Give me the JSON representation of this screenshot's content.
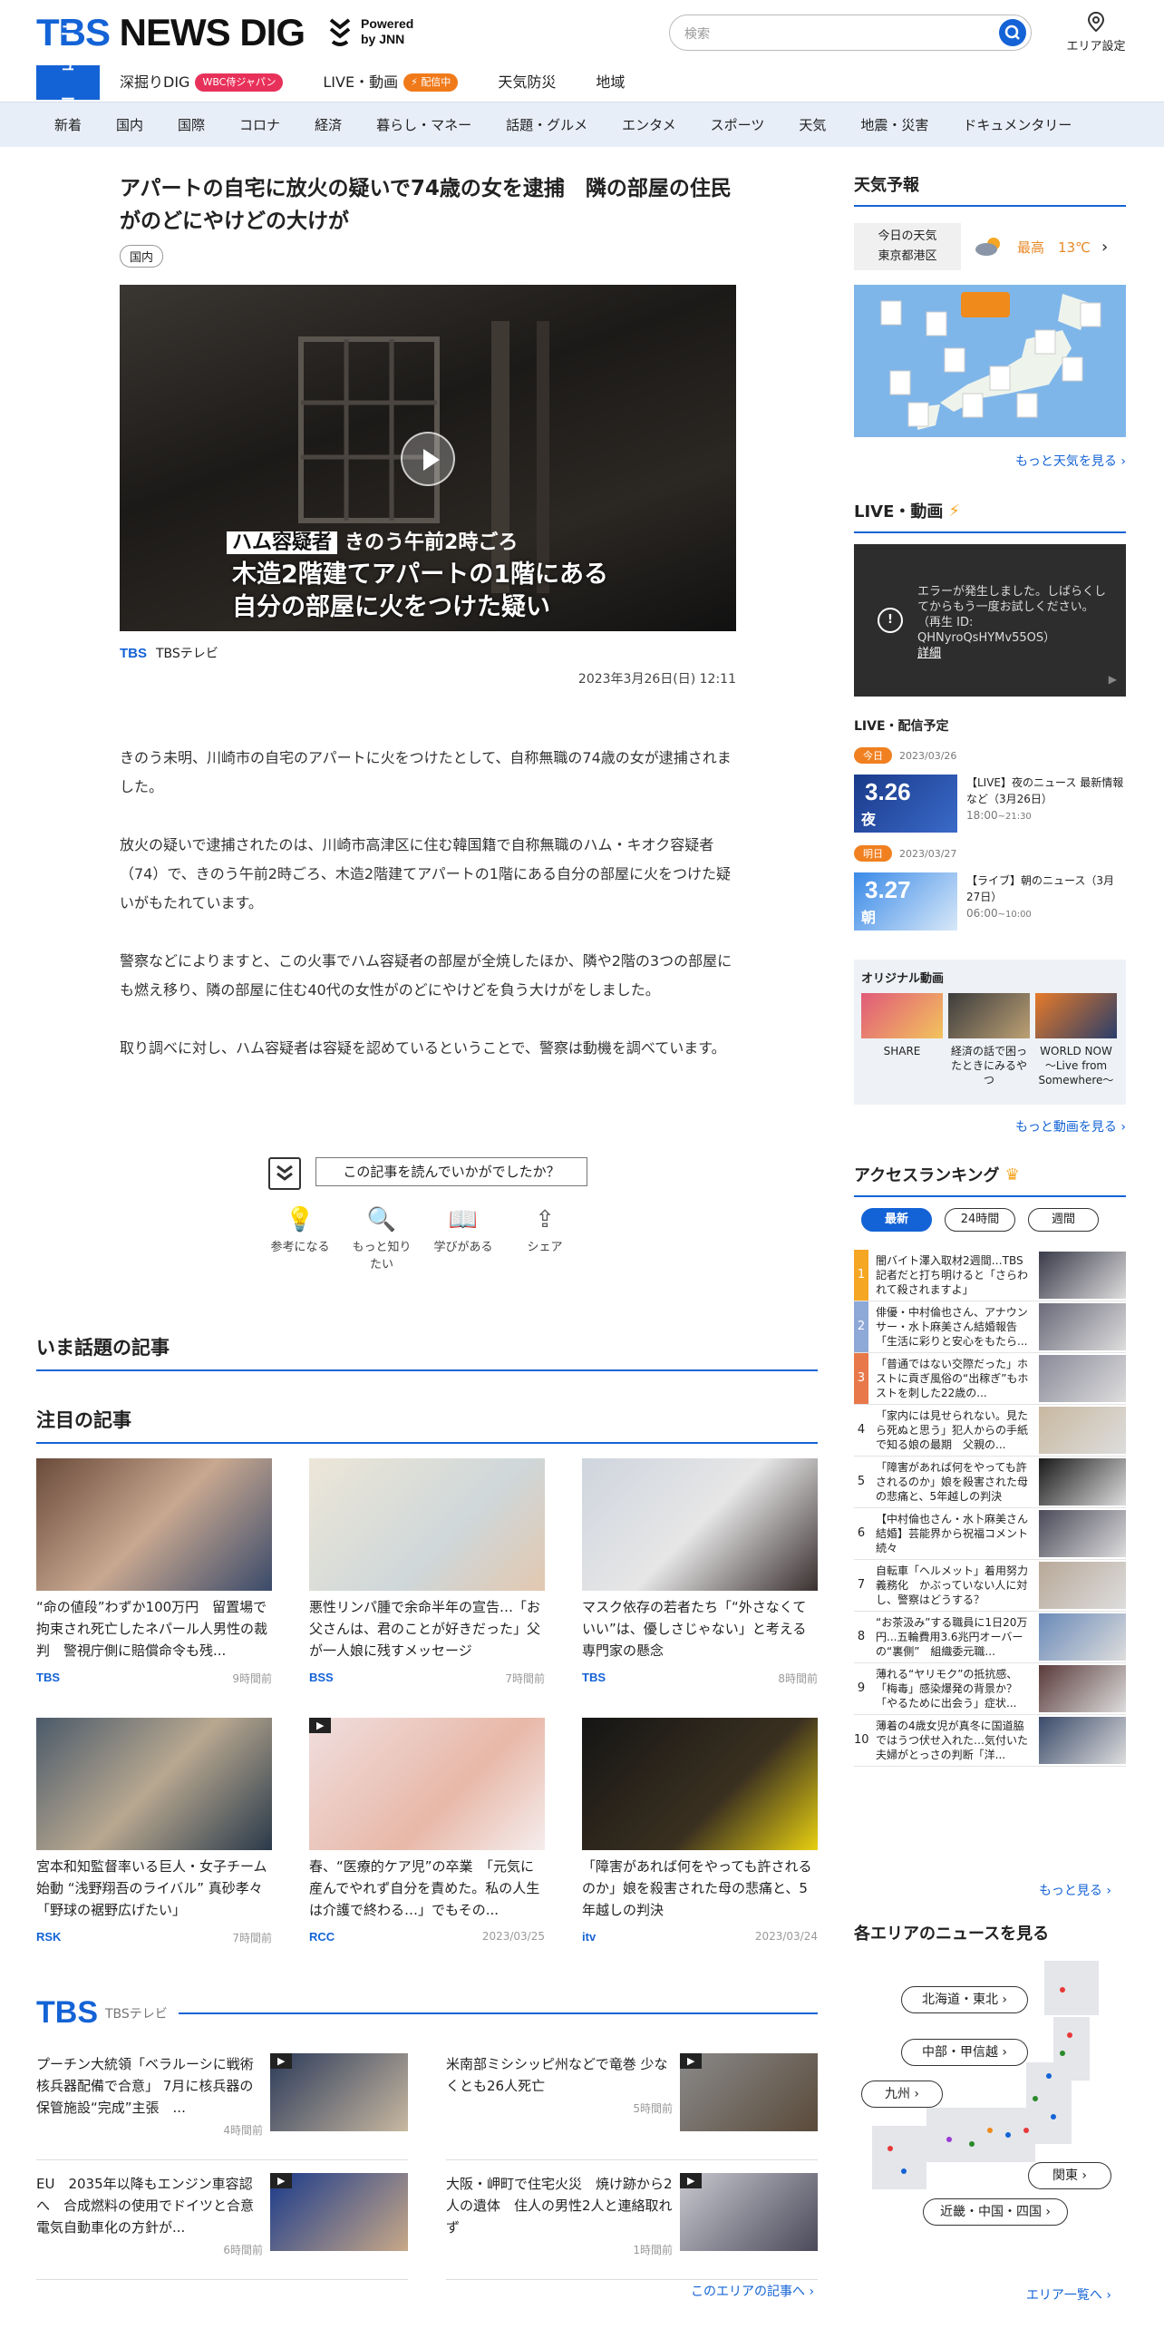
{
  "header": {
    "logo_tbs": "TBS",
    "logo_news": "NEWS DIG",
    "powered": "Powered",
    "by": "by JNN",
    "search_placeholder": "検索",
    "area_label": "エリア設定"
  },
  "main_nav": [
    {
      "label": "ニュース"
    },
    {
      "label": "深掘りDIG",
      "pill": "WBC侍ジャパン"
    },
    {
      "label": "LIVE・動画",
      "pill": "配信中"
    },
    {
      "label": "天気防災"
    },
    {
      "label": "地域"
    }
  ],
  "sub_nav": [
    "新着",
    "国内",
    "国際",
    "コロナ",
    "経済",
    "暮らし・マネー",
    "話題・グルメ",
    "エンタメ",
    "スポーツ",
    "天気",
    "地震・災害",
    "ドキュメンタリー"
  ],
  "article": {
    "title": "アパートの自宅に放火の疑いで74歳の女を逮捕　隣の部屋の住民がのどにやけどの大けが",
    "tag": "国内",
    "video_badge": "ハム容疑者",
    "video_caption1": "きのう午前2時ごろ",
    "video_caption2a": "木造2階建てアパートの1階にある",
    "video_caption2b": "自分の部屋に火をつけた疑い",
    "source_logo": "TBS",
    "source_name": "TBSテレビ",
    "date": "2023年3月26日(日) 12:11",
    "paragraphs": [
      "きのう未明、川崎市の自宅のアパートに火をつけたとして、自称無職の74歳の女が逮捕されました。",
      "放火の疑いで逮捕されたのは、川崎市高津区に住む韓国籍で自称無職のハム・キオク容疑者（74）で、きのう午前2時ごろ、木造2階建てアパートの1階にある自分の部屋に火をつけた疑いがもたれています。",
      "警察などによりますと、この火事でハム容疑者の部屋が全焼したほか、隣や2階の3つの部屋にも燃え移り、隣の部屋に住む40代の女性がのどにやけどを負う大けがをしました。",
      "取り調べに対し、ハム容疑者は容疑を認めているということで、警察は動機を調べています。"
    ],
    "feedback_question": "この記事を読んでいかがでしたか？",
    "reactions": [
      "参考になる",
      "もっと知りたい",
      "学びがある",
      "シェア"
    ]
  },
  "sections": {
    "trending": "いま話題の記事",
    "featured": "注目の記事"
  },
  "featured": [
    {
      "title": "“命の値段”わずか100万円　留置場で拘束され死亡したネパール人男性の裁判　警視庁側に賠償命令も残...",
      "brand": "TBS",
      "time": "9時間前"
    },
    {
      "title": "悪性リンパ腫で余命半年の宣告…「お父さんは、君のことが好きだった」父が一人娘に残すメッセージ",
      "brand": "BSS",
      "time": "7時間前"
    },
    {
      "title": "マスク依存の若者たち「“外さなくていい”は、優しさじゃない」と考える専門家の懸念",
      "brand": "TBS",
      "time": "8時間前"
    },
    {
      "title": "宮本和知監督率いる巨人・女子チーム始動 “浅野翔吾のライバル” 真砂孝々「野球の裾野広げたい」",
      "brand": "RSK",
      "time": "7時間前"
    },
    {
      "title": "春、“医療的ケア児”の卒業　「元気に産んでやれず自分を責めた。私の人生は介護で終わる…」でもその...",
      "brand": "RCC",
      "time": "2023/03/25"
    },
    {
      "title": "「障害があれば何をやっても許されるのか」娘を殺害された母の悲痛と、5年越しの判決",
      "brand": "itv",
      "time": "2023/03/24"
    }
  ],
  "tbs_block": {
    "logo": "TBS",
    "name": "TBSテレビ",
    "items": [
      {
        "title": "プーチン大統領「ベラルーシに戦術核兵器配備で合意」 7月に核兵器の保管施設“完成”主張　...",
        "time": "4時間前"
      },
      {
        "title": "米南部ミシシッピ州などで竜巻 少なくとも26人死亡",
        "time": "5時間前"
      },
      {
        "title": "EU　2035年以降もエンジン車容認へ　合成燃料の使用でドイツと合意　電気自動車化の方針が...",
        "time": "6時間前"
      },
      {
        "title": "大阪・岬町で住宅火災　焼け跡から2人の遺体　住人の男性2人と連絡取れず",
        "time": "1時間前"
      }
    ],
    "more": "このエリアの記事へ ›"
  },
  "sidebar": {
    "weather_head": "天気予報",
    "weather_today": "今日の天気",
    "weather_area": "東京都港区",
    "weather_high_label": "最高",
    "weather_high": "13℃",
    "weather_more": "もっと天気を見る ›",
    "live_head": "LIVE・動画",
    "live_error": "エラーが発生しました。しばらくしてからもう一度お試しください。（再生 ID: QHNyroQsHYMv55OS）",
    "live_error_link": "詳細",
    "schedule_head": "LIVE・配信予定",
    "schedule": [
      {
        "badge": "今日",
        "date": "2023/03/26",
        "thumb_date": "3.26",
        "thumb_sub": "夜",
        "title": "【LIVE】夜のニュース 最新情報など（3月26日）",
        "time": "18:00",
        "end": "~21:30"
      },
      {
        "badge": "明日",
        "date": "2023/03/27",
        "thumb_date": "3.27",
        "thumb_sub": "朝",
        "title": "【ライブ】朝のニュース（3月27日）",
        "time": "06:00",
        "end": "~10:00"
      }
    ],
    "original_head": "オリジナル動画",
    "original": [
      "SHARE",
      "経済の話で困ったときにみるやつ",
      "WORLD NOW ～Live from Somewhere～"
    ],
    "video_more": "もっと動画を見る ›",
    "ranking_head": "アクセスランキング",
    "ranking_tabs": [
      "最新",
      "24時間",
      "週間"
    ],
    "ranking": [
      {
        "n": "1",
        "title": "闇バイト澤入取材2週間…TBS記者だと打ち明けると「さらわれて殺されますよ」"
      },
      {
        "n": "2",
        "title": "俳優・中村倫也さん、アナウンサー・水卜麻美さん結婚報告「生活に彩りと安心をもたら..."
      },
      {
        "n": "3",
        "title": "「普通ではない交際だった」ホストに貢ぎ風俗の“出稼ぎ”もホストを刺した22歳の..."
      },
      {
        "n": "4",
        "title": "「家内には見せられない。見たら死ぬと思う」犯人からの手紙で知る娘の最期　父親の..."
      },
      {
        "n": "5",
        "title": "「障害があれば何をやっても許されるのか」娘を殺害された母の悲痛と、5年越しの判決"
      },
      {
        "n": "6",
        "title": "【中村倫也さん・水卜麻美さん結婚】芸能界から祝福コメント続々"
      },
      {
        "n": "7",
        "title": "自転車「ヘルメット」着用努力義務化　かぶっていない人に対し、警察はどうする？"
      },
      {
        "n": "8",
        "title": "“お茶汲み”する職員に1日20万円...五輪費用3.6兆円オーバーの“裏側”　組織委元職..."
      },
      {
        "n": "9",
        "title": "薄れる“ヤリモク”の抵抗感、「梅毒」感染爆発の背景か？「やるために出会う」症状..."
      },
      {
        "n": "10",
        "title": "薄着の4歳女児が真冬に国道脇ではうつ伏せ入れた…気付いた夫婦がとっさの判断「洋..."
      }
    ],
    "ranking_more": "もっと見る ›",
    "area_head": "各エリアのニュースを見る",
    "areas": [
      "北海道・東北 ›",
      "中部・甲信越 ›",
      "九州 ›",
      "関東 ›",
      "近畿・中国・四国 ›"
    ],
    "area_more": "エリア一覧へ ›"
  }
}
